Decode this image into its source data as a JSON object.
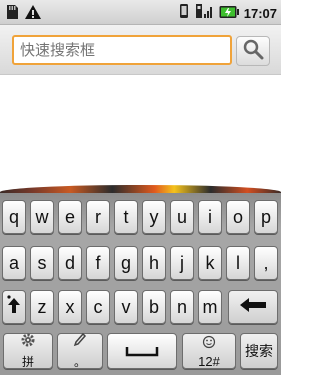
{
  "status_bar": {
    "time": "17:07",
    "icons": [
      "sd-card-icon",
      "warning-icon",
      "vibrate-icon",
      "signal-icon",
      "battery-charging-icon"
    ]
  },
  "search": {
    "placeholder": "快速搜索框",
    "value": ""
  },
  "keyboard": {
    "row1": [
      "q",
      "w",
      "e",
      "r",
      "t",
      "y",
      "u",
      "i",
      "o",
      "p"
    ],
    "row2": [
      "a",
      "s",
      "d",
      "f",
      "g",
      "h",
      "j",
      "k",
      "l",
      ","
    ],
    "row3": [
      "z",
      "x",
      "c",
      "v",
      "b",
      "n",
      "m"
    ],
    "settings_label": "拼",
    "handwriting_label": "。",
    "symbols_label": "12#",
    "search_label": "搜索"
  },
  "colors": {
    "accent": "#f0a33a",
    "keyboard_bg": "#9a9a9a",
    "status_bg": "#d8d8d8"
  }
}
